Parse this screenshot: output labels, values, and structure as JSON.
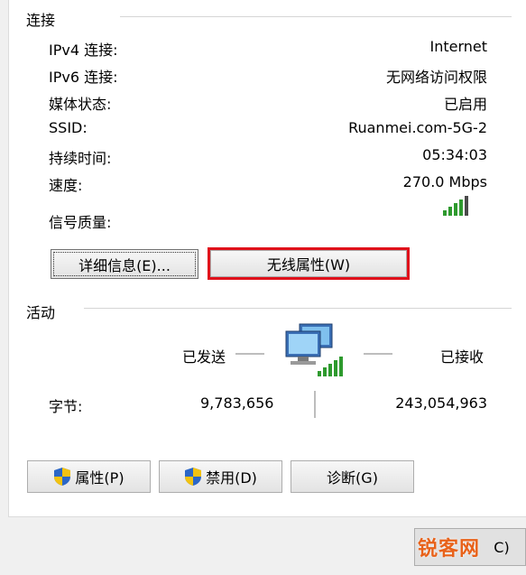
{
  "connection": {
    "title": "连接",
    "rows": [
      {
        "label": "IPv4 连接:",
        "value": "Internet"
      },
      {
        "label": "IPv6 连接:",
        "value": "无网络访问权限"
      },
      {
        "label": "媒体状态:",
        "value": "已启用"
      },
      {
        "label": "SSID:",
        "value": "Ruanmei.com-5G-2"
      },
      {
        "label": "持续时间:",
        "value": "05:34:03"
      },
      {
        "label": "速度:",
        "value": "270.0 Mbps"
      }
    ],
    "signal_label": "信号质量:",
    "signal_icon": "signal-bars-icon",
    "details_button": "详细信息(E)...",
    "wireless_props_button": "无线属性(W)"
  },
  "activity": {
    "title": "活动",
    "sent_label": "已发送",
    "received_label": "已接收",
    "bytes_label": "字节:",
    "bytes_sent": "9,783,656",
    "bytes_received": "243,054,963",
    "network_icon": "network-computers-icon"
  },
  "buttons": {
    "properties": "属性(P)",
    "disable": "禁用(D)",
    "diagnose": "诊断(G)",
    "shield_icon": "uac-shield-icon"
  },
  "footer": {
    "button_tail": "C)",
    "watermark": "锐客网"
  },
  "colors": {
    "highlight": "#e0111b",
    "signal": "#2e9a2e",
    "watermark": "#e8621a"
  }
}
